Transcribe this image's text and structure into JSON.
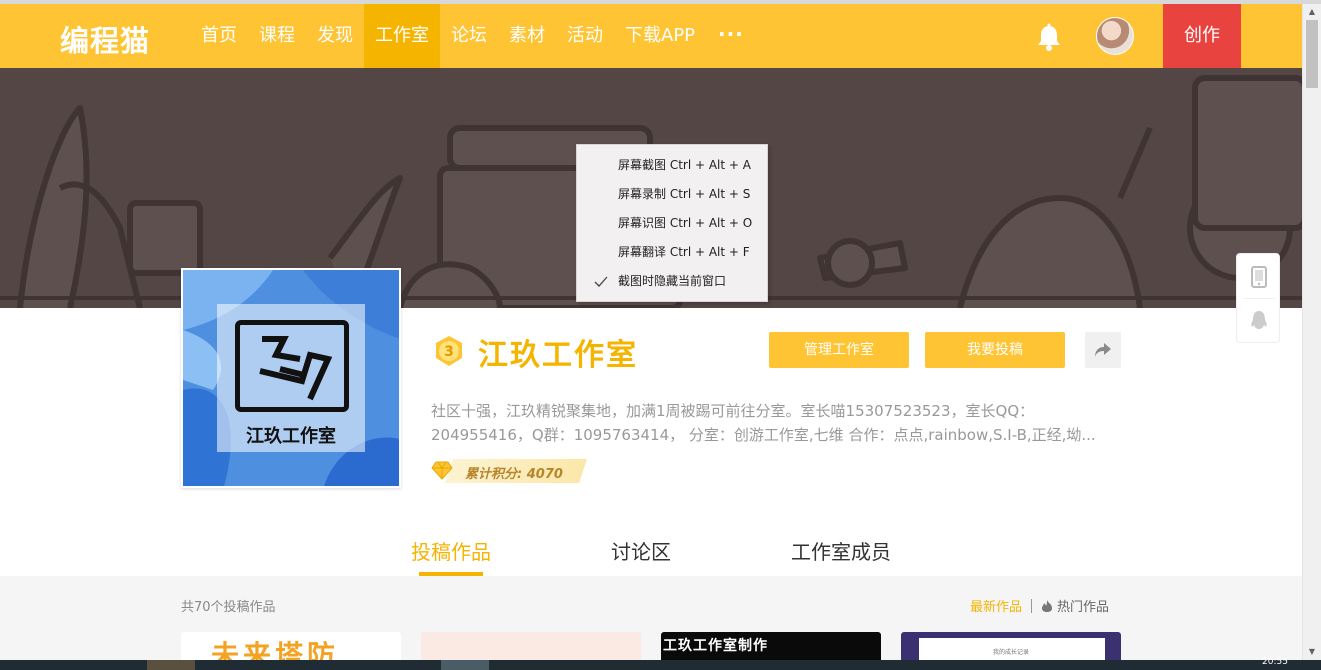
{
  "header": {
    "logo": "编程猫",
    "nav": [
      {
        "label": "首页",
        "active": false
      },
      {
        "label": "课程",
        "active": false
      },
      {
        "label": "发现",
        "active": false
      },
      {
        "label": "工作室",
        "active": true
      },
      {
        "label": "论坛",
        "active": false
      },
      {
        "label": "素材",
        "active": false
      },
      {
        "label": "活动",
        "active": false
      },
      {
        "label": "下载APP",
        "active": false
      }
    ],
    "more": "···",
    "create_label": "创作"
  },
  "studio": {
    "cover_text": "江玖工作室",
    "level": "3",
    "name": "江玖工作室",
    "manage_label": "管理工作室",
    "submit_label": "我要投稿",
    "description_lines": [
      "社区十强，江玖精锐聚集地，加满1周被踢可前往分室。室长喵15307523523，室长QQ：",
      "204955416，Q群：1095763414， 分室：创游工作室,七维 合作：点点,rainbow,S.I-B,正经,坳..."
    ],
    "points": "累计积分: 4070"
  },
  "tabs": [
    {
      "label": "投稿作品",
      "active": true
    },
    {
      "label": "讨论区",
      "active": false
    },
    {
      "label": "工作室成员",
      "active": false
    }
  ],
  "works": {
    "total": "共70个投稿作品",
    "filter_latest": "最新作品",
    "filter_hot": "热门作品",
    "cards": [
      {
        "text": "未来塔防"
      },
      {
        "text": ""
      },
      {
        "text": "工玖工作室制作"
      },
      {
        "text": "我的成长记录"
      }
    ]
  },
  "context_menu": {
    "items": [
      {
        "label": "屏幕截图 Ctrl + Alt + A",
        "checked": false
      },
      {
        "label": "屏幕录制 Ctrl + Alt + S",
        "checked": false
      },
      {
        "label": "屏幕识图 Ctrl + Alt + O",
        "checked": false
      },
      {
        "label": "屏幕翻译 Ctrl + Alt + F",
        "checked": false
      },
      {
        "label": "截图时隐藏当前窗口",
        "checked": true
      }
    ]
  },
  "taskbar": {
    "clock": "20:55"
  },
  "colors": {
    "brand": "#fec433",
    "brand_dark": "#f4b400",
    "create_button": "#e9433f",
    "banner": "#534645"
  },
  "icons": {
    "bell": "bell-icon",
    "share": "share-icon",
    "tablet": "tablet-icon",
    "qq": "qq-icon",
    "flame": "flame-icon",
    "gem": "gem-icon",
    "check": "check-icon"
  }
}
